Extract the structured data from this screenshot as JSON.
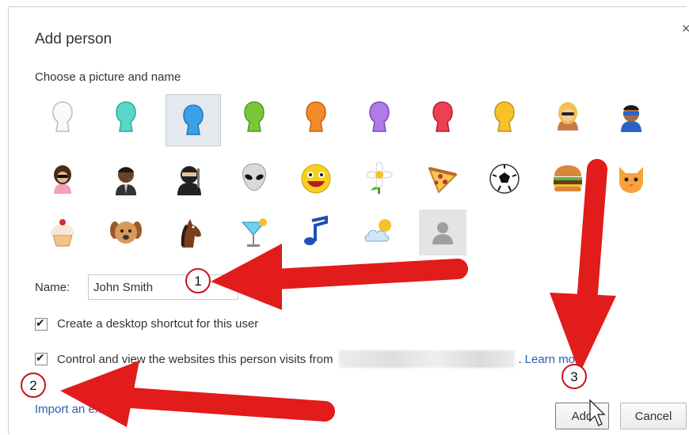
{
  "dialog": {
    "title": "Add person",
    "subtitle": "Choose a picture and name",
    "close_icon": "close-icon"
  },
  "avatars": [
    "white-silhouette",
    "teal-silhouette",
    "blue-silhouette",
    "green-silhouette",
    "orange-silhouette",
    "purple-silhouette",
    "red-silhouette",
    "yellow-silhouette",
    "blonde-woman",
    "masked-hero",
    "dark-haired-woman",
    "businessman",
    "ninja",
    "alien",
    "smiley-face",
    "daisy-flower",
    "pizza-slice",
    "soccer-ball",
    "hamburger",
    "orange-cat",
    "cupcake",
    "dog",
    "horse",
    "cocktail-glass",
    "music-note",
    "sun-cloud",
    "generic-profile"
  ],
  "selected_avatar": "blue-silhouette",
  "name": {
    "label": "Name:",
    "value": "John Smith"
  },
  "options": {
    "shortcut_label": "Create a desktop shortcut for this user",
    "shortcut_checked": true,
    "supervise_label": "Control and view the websites this person visits from",
    "supervise_checked": true,
    "learn_more_prefix": ".",
    "learn_more_label": "Learn more"
  },
  "footer": {
    "import_link": "Import an existing",
    "add_label": "Add",
    "cancel_label": "Cancel"
  },
  "annotations": {
    "callout_1": "1",
    "callout_2": "2",
    "callout_3": "3",
    "arrow_color": "#e21b1b"
  }
}
